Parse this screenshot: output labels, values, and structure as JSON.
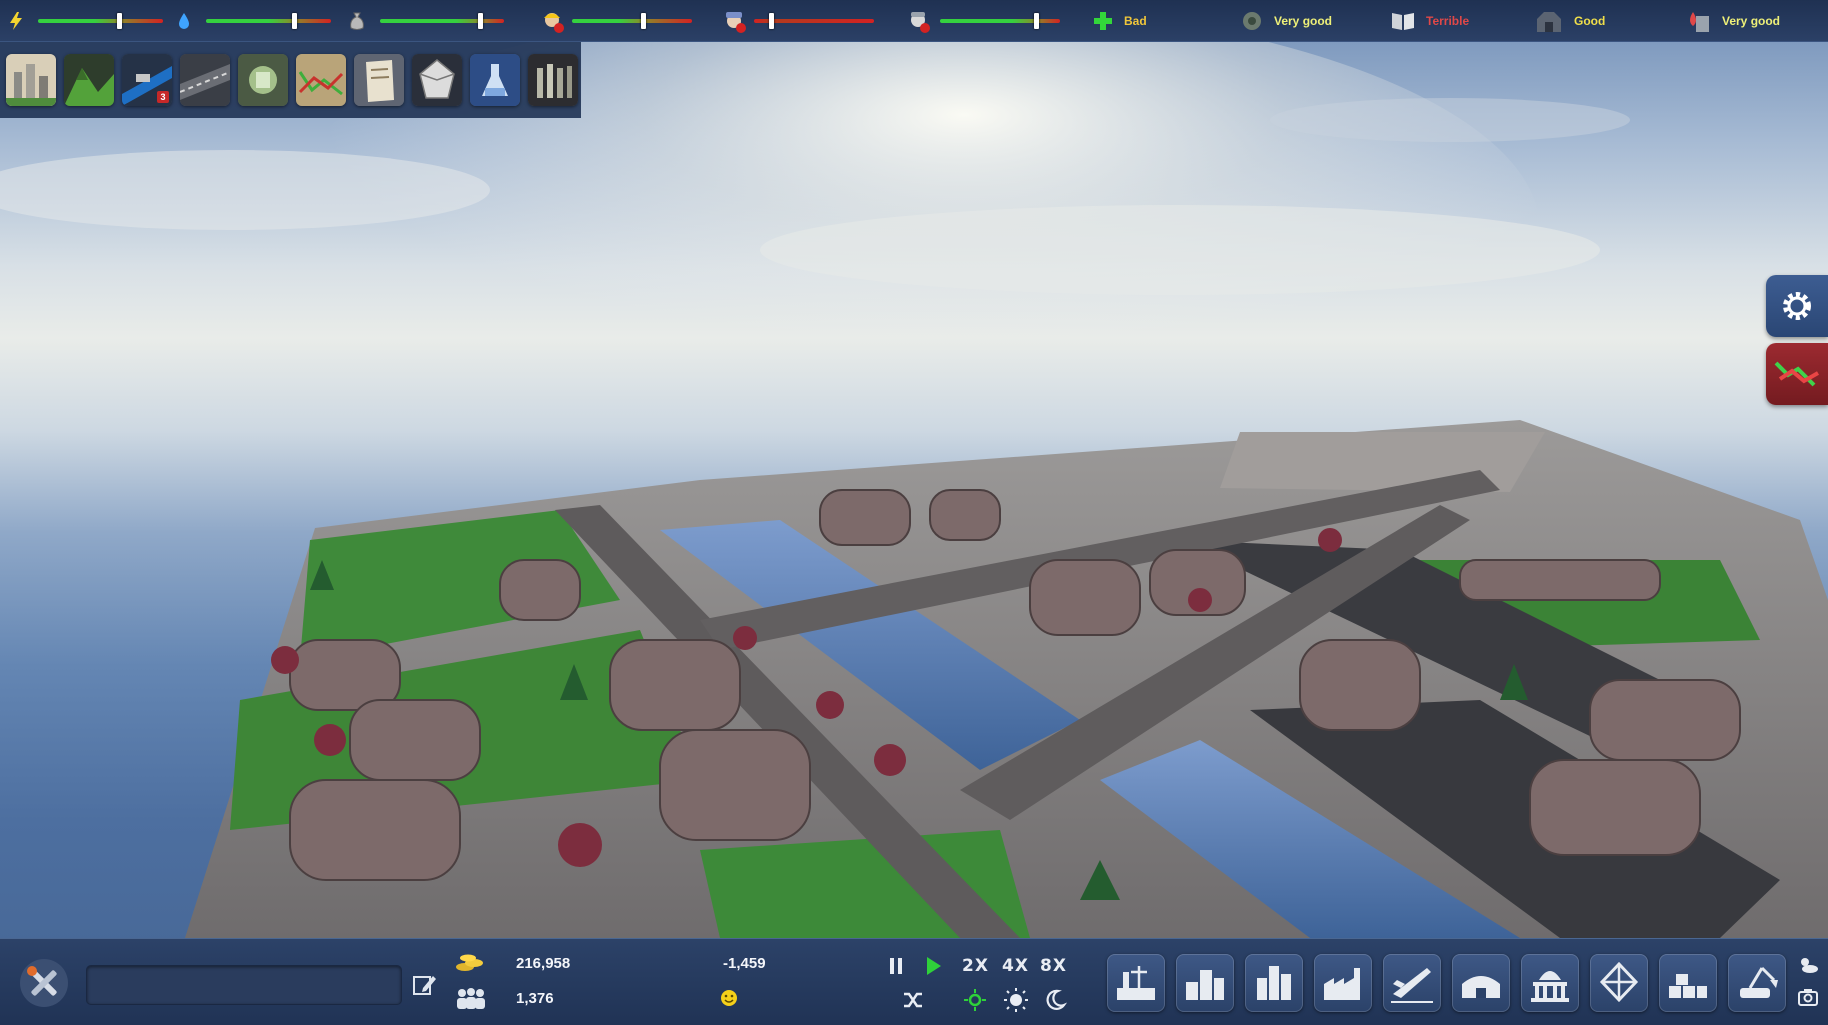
{
  "top_bar": {
    "sliders": [
      {
        "icon": "lightning-icon",
        "level": 0.65,
        "color": "#f2d430"
      },
      {
        "icon": "water-drop-icon",
        "level": 0.7,
        "color": "#3fa4ff"
      },
      {
        "icon": "money-bag-icon",
        "level": 0.81,
        "color": "#b9b9b9"
      },
      {
        "icon": "worker-icon",
        "level": 0.59,
        "color": "#f5c518"
      },
      {
        "icon": "police-icon",
        "level": 0.14,
        "color": "#7a8fc9"
      },
      {
        "icon": "citizen-icon",
        "level": 0.8,
        "color": "#b9b9b9"
      }
    ],
    "statuses": [
      {
        "icon": "health-cross-icon",
        "text": "Bad",
        "color": "#f0c63a"
      },
      {
        "icon": "ecology-icon",
        "text": "Very good",
        "color": "#eef078"
      },
      {
        "icon": "education-book-icon",
        "text": "Terrible",
        "color": "#e04848"
      },
      {
        "icon": "safety-icon",
        "text": "Good",
        "color": "#f0df4a"
      },
      {
        "icon": "fire-icon",
        "text": "Very good",
        "color": "#eef078"
      }
    ]
  },
  "toolbar": {
    "tools": [
      {
        "icon": "city-view-icon",
        "interactable": true
      },
      {
        "icon": "terrain-icon",
        "interactable": true
      },
      {
        "icon": "traffic-icon",
        "interactable": true,
        "badge": "3"
      },
      {
        "icon": "roads-icon",
        "interactable": true
      },
      {
        "icon": "finance-icon",
        "interactable": true
      },
      {
        "icon": "economy-chart-icon",
        "interactable": true
      },
      {
        "icon": "policies-document-icon",
        "interactable": true
      },
      {
        "icon": "resources-crystal-icon",
        "interactable": true
      },
      {
        "icon": "research-flask-icon",
        "interactable": true
      },
      {
        "icon": "statistics-library-icon",
        "interactable": true
      }
    ]
  },
  "side_buttons": [
    {
      "icon": "settings-gear-icon"
    },
    {
      "icon": "trend-graph-icon"
    }
  ],
  "bottom_bar": {
    "city_name_value": "",
    "money": "216,958",
    "population": "1,376",
    "income": "-1,459",
    "happiness_icon": "smiley-icon",
    "speed": {
      "x2": "2X",
      "x4": "4X",
      "x8": "8X"
    },
    "build_categories": [
      {
        "icon": "power-plant-icon"
      },
      {
        "icon": "residential-icon"
      },
      {
        "icon": "commercial-icon"
      },
      {
        "icon": "industrial-icon"
      },
      {
        "icon": "airport-icon"
      },
      {
        "icon": "services-icon"
      },
      {
        "icon": "landmarks-icon"
      },
      {
        "icon": "structures-icon"
      },
      {
        "icon": "storage-icon"
      },
      {
        "icon": "bulldozer-icon"
      }
    ]
  },
  "colors": {
    "bar_bg": "#24395c",
    "accent_green": "#33d63a",
    "slider_red": "#d32222",
    "slider_green": "#35d13f"
  }
}
